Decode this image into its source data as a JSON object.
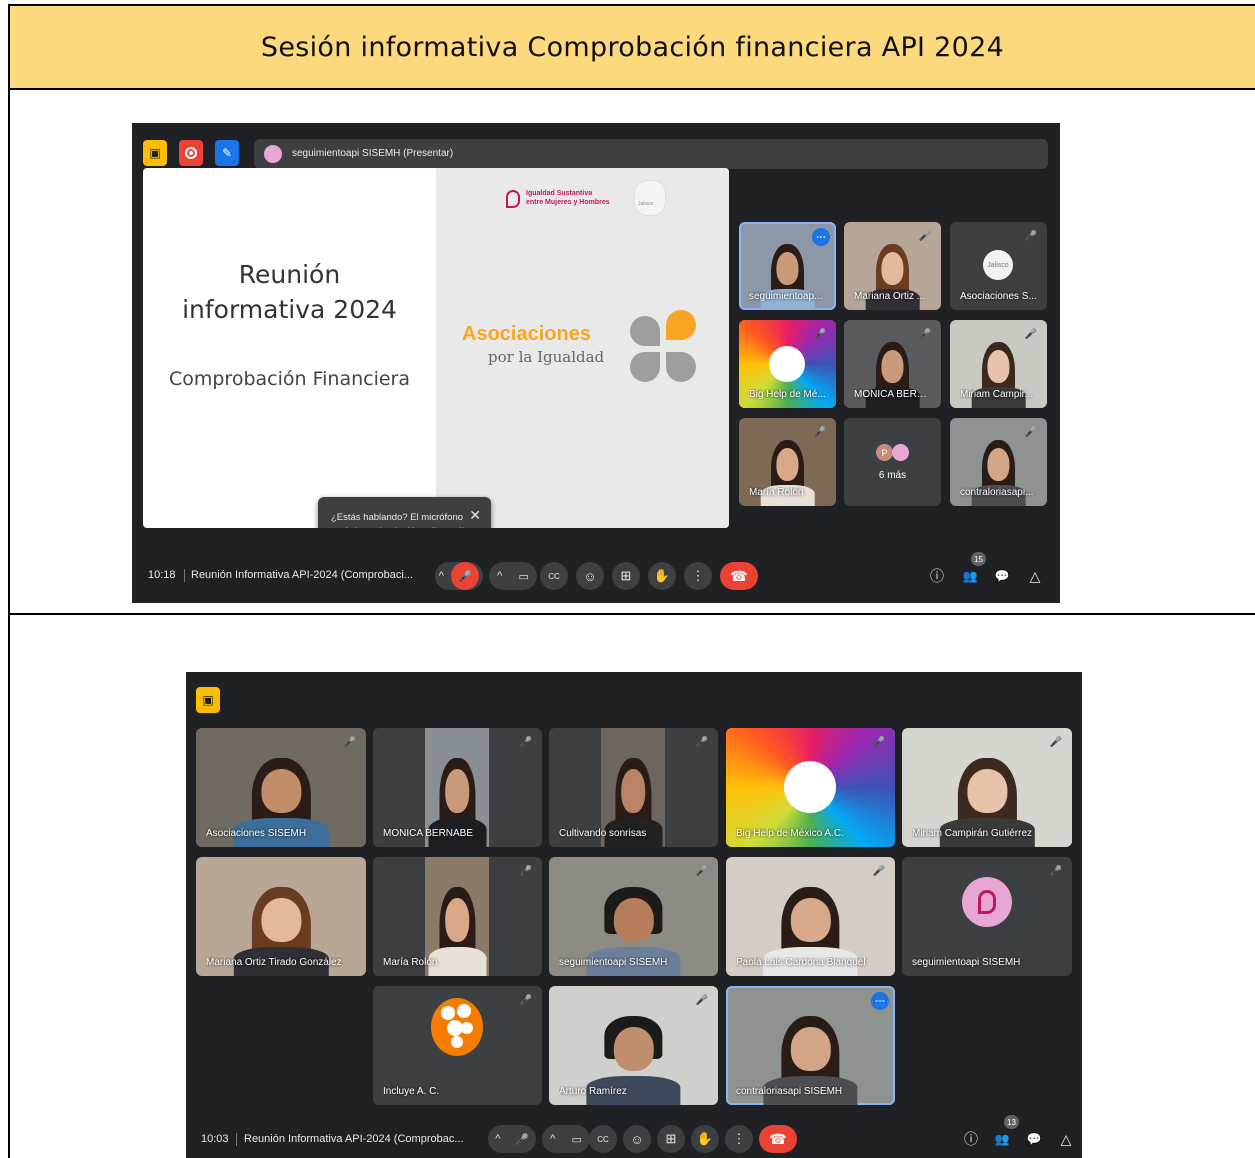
{
  "title": "Sesión informativa Comprobación financiera API 2024",
  "top": {
    "presenter_chip": "seguimientoapi SISEMH (Presentar)",
    "slide": {
      "heading_line1": "Reunión",
      "heading_line2": "informativa 2024",
      "subheading": "Comprobación Financiera",
      "brand_line1": "Igualdad Sustantiva",
      "brand_line2": "entre Mujeres y Hombres",
      "seal_text": "Jalisco",
      "assoc_title": "Asociaciones",
      "assoc_sub": "por la Igualdad"
    },
    "tooltip": {
      "text": "¿Estás hablando? El micrófono está desactivado. Haz clic en él para activarlo.",
      "close": "✕"
    },
    "tiles": [
      "seguimientoap...",
      "Mariana Ortiz ...",
      "Asociaciones S...",
      "Big Help de Mé...",
      "MONICA BERN...",
      "Miriam Campir...",
      "María Rolón",
      "6 más",
      "contraloriasapi..."
    ],
    "more_avatar": "P",
    "seal_small": "Jalisco",
    "time": "10:18",
    "meeting": "Reunión Informativa API-2024 (Comprobaci...",
    "people_count": "15"
  },
  "bottom": {
    "tiles": [
      "Asociaciones SISEMH",
      "MONICA BERNABE",
      "Cultivando sonrisas",
      "Big Help de México A.C.",
      "Miriam Campirán Gutiérrez",
      "Mariana Ortiz Tirado González",
      "María Rolón",
      "seguimientoapi SISEMH",
      "Paola Lais Cardona Blanquel",
      "seguimientoapi SISEMH",
      "Incluye A. C.",
      "Arturo Ramírez",
      "contraloriasapi SISEMH"
    ],
    "time": "10:03",
    "meeting": "Reunión Informativa API-2024 (Comprobac...",
    "people_count": "13"
  },
  "icons": {
    "mic_off": "🎤",
    "chevron_up": "^",
    "camera": "▭",
    "captions": "CC",
    "emoji": "☺",
    "present": "⊞",
    "hand": "✋",
    "more": "⋮",
    "hangup": "☎",
    "info": "ⓘ",
    "people": "👥",
    "chat": "💬",
    "activities": "△"
  },
  "colors": {
    "title_bg": "#fcd97d",
    "meet_bg": "#202124",
    "tile_bg": "#3c4043",
    "hangup": "#ea4335",
    "assoc_orange": "#f6a623",
    "brand_pink": "#c2185b"
  }
}
